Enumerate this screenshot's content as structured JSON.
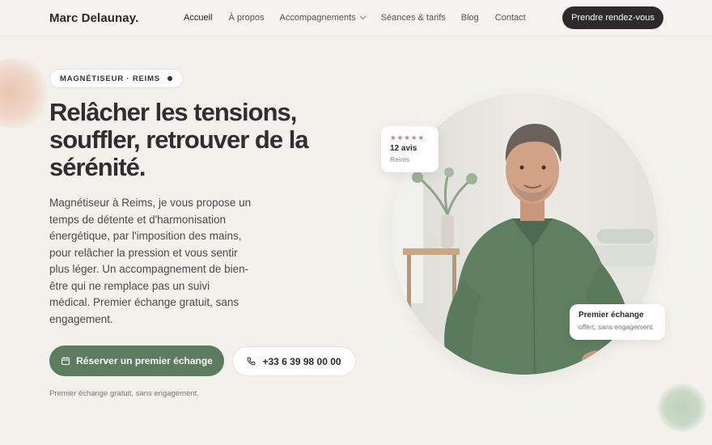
{
  "brand": {
    "name": "Marc Delaunay."
  },
  "nav": {
    "items": [
      {
        "label": "Accueil"
      },
      {
        "label": "À propos"
      },
      {
        "label": "Accompagnements"
      },
      {
        "label": "Séances & tarifs"
      },
      {
        "label": "Blog"
      },
      {
        "label": "Contact"
      }
    ],
    "cta_label": "Prendre rendez-vous"
  },
  "hero": {
    "badge": "MAGNÉTISEUR · REIMS",
    "title": "Relâcher les tensions, souffler, retrouver de la sérénité.",
    "description": "Magnétiseur à Reims, je vous propose un temps de détente et d'harmonisation énergétique, par l'imposition des mains, pour relâcher la pression et vous sentir plus léger. Un accompagnement de bien-être qui ne remplace pas un suivi médical. Premier échange gratuit, sans engagement.",
    "primary_button": "Réserver un premier échange",
    "phone_button": "+33 6 39 98 00 00",
    "note": "Premier échange gratuit, sans engagement."
  },
  "reviews_card": {
    "stars": "★★★★★",
    "count": "12 avis",
    "city": "Reims"
  },
  "first_exchange_card": {
    "title": "Premier échange",
    "subtitle": "offert, sans engagement"
  },
  "icons": {
    "dropdown": "chevron-down-icon",
    "calendar": "calendar-icon",
    "phone": "phone-icon"
  },
  "colors": {
    "background": "#f2f1ec",
    "dark_button": "#2b2b2b",
    "accent_green": "#5b7d5e",
    "star": "#cf7a72"
  }
}
